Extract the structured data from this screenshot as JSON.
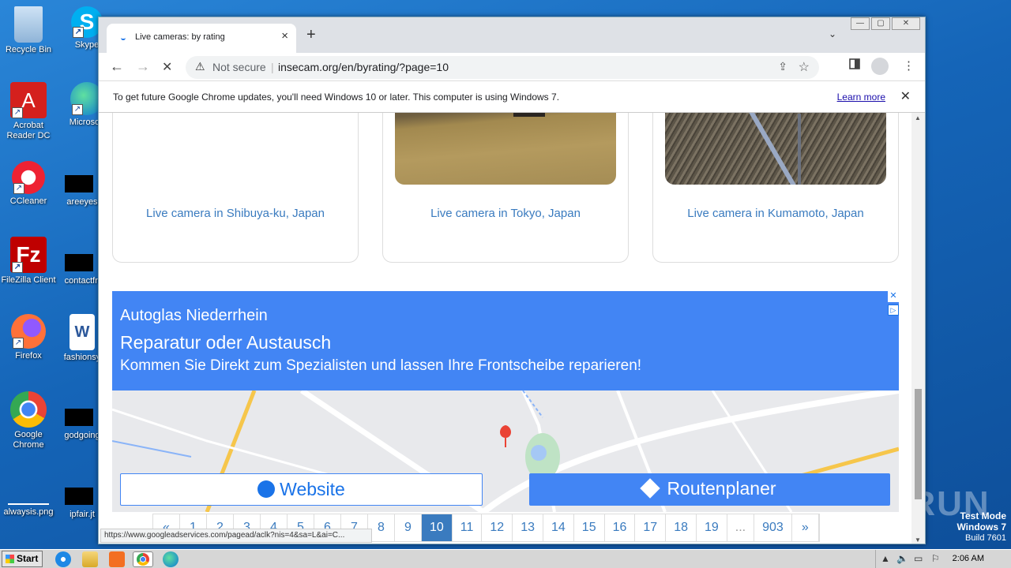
{
  "desktop": {
    "icons": [
      {
        "label": "Recycle Bin"
      },
      {
        "label": "Skype"
      },
      {
        "label": "Acrobat Reader DC"
      },
      {
        "label": "Microsoft"
      },
      {
        "label": "CCleaner"
      },
      {
        "label": "areeyes"
      },
      {
        "label": "FileZilla Client"
      },
      {
        "label": "contactfri"
      },
      {
        "label": "Firefox"
      },
      {
        "label": "fashionsy"
      },
      {
        "label": "Google Chrome"
      },
      {
        "label": "godgoing"
      },
      {
        "label": "alwaysis.png"
      },
      {
        "label": "ipfair.jt"
      }
    ],
    "testmode": {
      "line1": "Test Mode",
      "line2": "Windows 7",
      "line3": "Build 7601"
    },
    "watermark": "ANY RUN"
  },
  "browser": {
    "tab": {
      "title": "Live cameras: by rating",
      "close": "×"
    },
    "newtab": "+",
    "tabs_menu": "⌄",
    "winctl": {
      "min": "—",
      "max": "▢",
      "close": "✕"
    },
    "nav": {
      "back": "←",
      "forward": "→",
      "stop": "✕"
    },
    "omnibox": {
      "warn": "⚠",
      "security": "Not secure",
      "sep": "|",
      "url": "insecam.org/en/byrating/?page=10",
      "share": "⇪",
      "star": "☆"
    },
    "infobar": {
      "message": "To get future Google Chrome updates, you'll need Windows 10 or later. This computer is using Windows 7.",
      "link": "Learn more",
      "close": "✕"
    },
    "status_url": "https://www.googleadservices.com/pagead/aclk?nis=4&sa=L&ai=C..."
  },
  "page": {
    "cards": [
      {
        "caption": "Live camera in Shibuya-ku, Japan"
      },
      {
        "caption": "Live camera in Tokyo, Japan"
      },
      {
        "caption": "Live camera in Kumamoto, Japan"
      }
    ],
    "ad": {
      "line1": "Autoglas Niederrhein",
      "line2": "Reparatur oder Austausch",
      "line3": "Kommen Sie Direkt zum Spezialisten und lassen Ihre Frontscheibe reparieren!",
      "website_label": "Website",
      "route_label": "Routenplaner",
      "close": "✕",
      "info": "▷"
    },
    "pagination": [
      "«",
      "1",
      "2",
      "3",
      "4",
      "5",
      "6",
      "7",
      "8",
      "9",
      "10",
      "11",
      "12",
      "13",
      "14",
      "15",
      "16",
      "17",
      "18",
      "19",
      "...",
      "903",
      "»"
    ],
    "current_page": "10"
  },
  "taskbar": {
    "start": "Start",
    "clock": "2:06 AM"
  },
  "colors": {
    "link": "#3a7bbf",
    "ad_blue": "#4285f4",
    "desktop": "#1d6fc4"
  }
}
